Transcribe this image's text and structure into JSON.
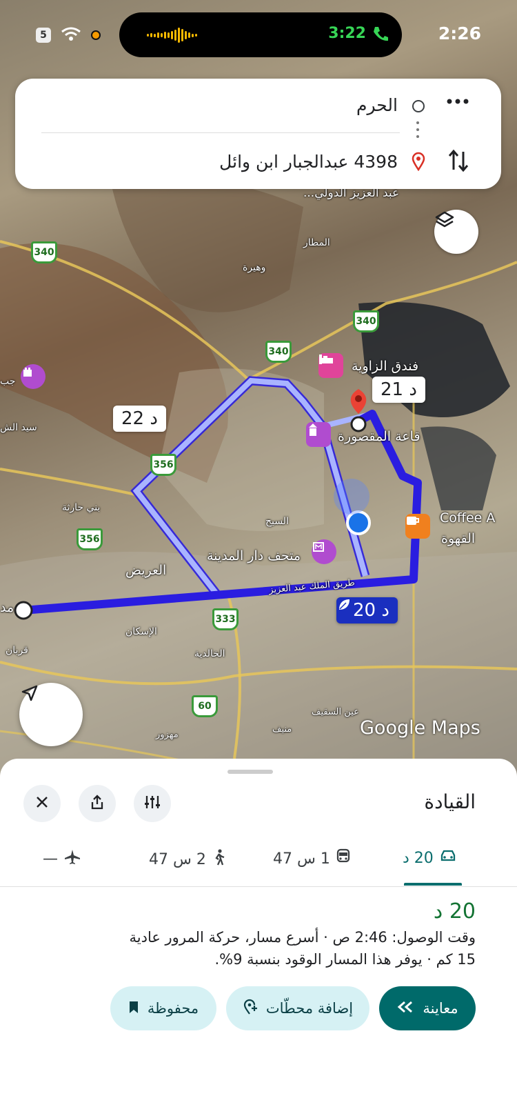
{
  "status_bar": {
    "clock": "2:26",
    "call_time": "3:22",
    "sim_label": "5"
  },
  "search": {
    "origin": "الحرم",
    "destination": "4398 عبدالجبار ابن وائل"
  },
  "map": {
    "labels": {
      "airport": "عبد العزيز الدولي...",
      "matar": "المطار",
      "wahra": "وهيرة",
      "hotel": "فندق الزاوية",
      "hall": "قاعة المقصورة",
      "coffee_en": "Coffee A",
      "coffee_ar": "القهوة",
      "museum": "متحف دار المدينة",
      "sabeel": "السيح",
      "king_rd": "طريق الملك عبد العزيز",
      "uraydh": "العريض",
      "bani_haritha": "بني حارثة",
      "sayed": "سيد الش",
      "jabal": "جب",
      "iskan": "الإسكان",
      "khalidiya": "الخالدية",
      "qurban": "قربان",
      "ain": "عين السقيف",
      "mahzour": "مهزور",
      "muneef": "منيف",
      "left_city": "مد"
    },
    "shields": [
      "340",
      "340",
      "340",
      "356",
      "356",
      "333",
      "60"
    ],
    "eta_alt_1": "21 د",
    "eta_alt_2": "22 د",
    "eta_selected": "20 د",
    "watermark": "Google Maps"
  },
  "sheet": {
    "title": "القيادة",
    "modes": [
      {
        "label": "20 د",
        "icon": "car-icon"
      },
      {
        "label": "1 س 47",
        "icon": "transit-icon"
      },
      {
        "label": "2 س 47",
        "icon": "walk-icon"
      },
      {
        "label": "—",
        "icon": "flight-icon"
      }
    ],
    "duration": "20 د",
    "arrival_line": "وقت الوصول: 2:46 ص · أسرع مسار، حركة المرور عادية",
    "eco_line": "15 كم · يوفر هذا المسار الوقود بنسبة 9%.",
    "actions": {
      "preview": "معاينة",
      "add_stops": "إضافة محطّات",
      "saved": "محفوظة"
    }
  },
  "colors": {
    "route": "#2a1de0",
    "alt_route": "#a9b4ff",
    "accent": "#006a6a"
  }
}
